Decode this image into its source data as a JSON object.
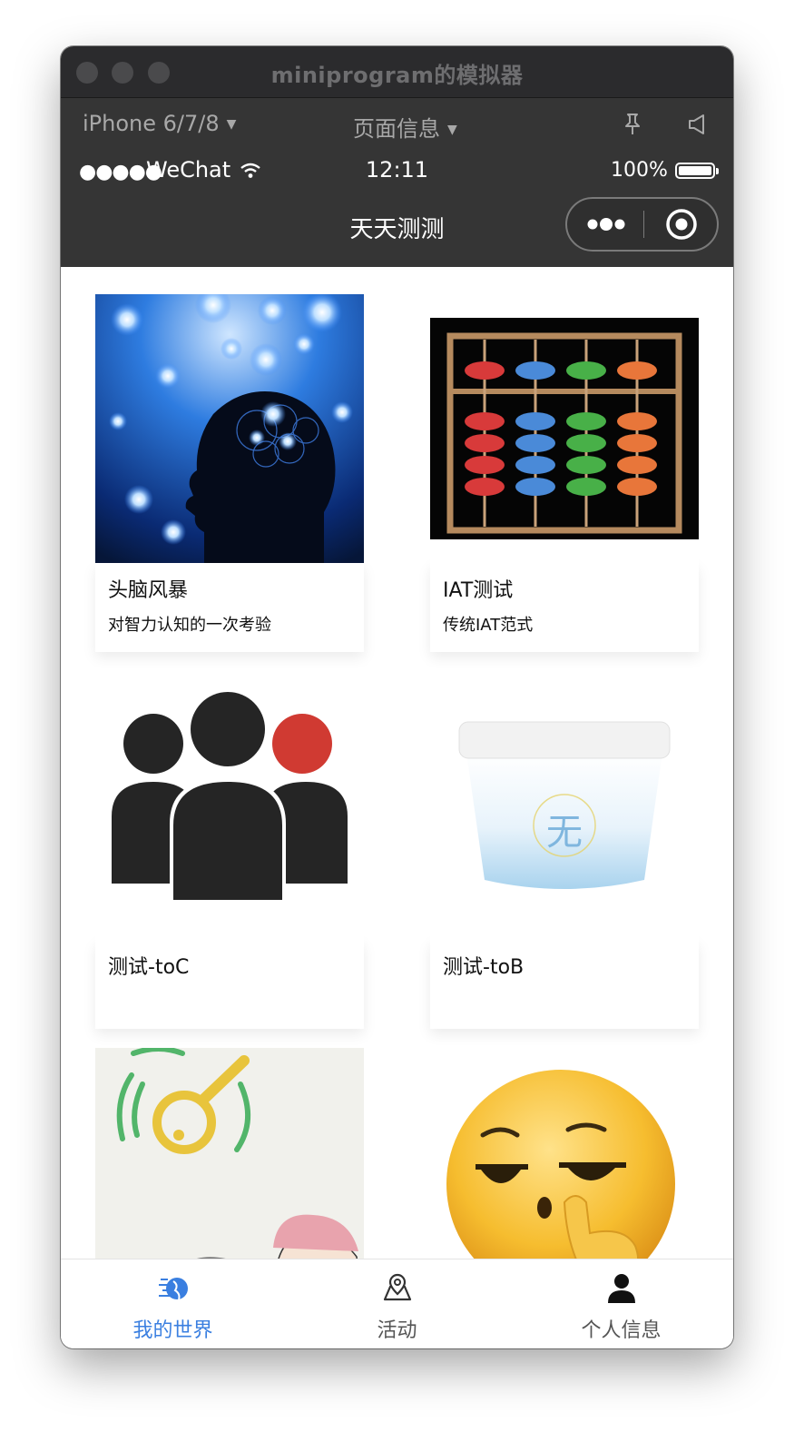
{
  "window": {
    "title": "miniprogram的模拟器"
  },
  "devbar": {
    "device": "iPhone 6/7/8",
    "page_info": "页面信息",
    "pin_icon": "pin-icon",
    "sound_icon": "speaker-icon"
  },
  "statusbar": {
    "signal": "●●●●●",
    "carrier": "WeChat",
    "time": "12:11",
    "battery": "100%",
    "battery_level": 1.0
  },
  "navbar": {
    "title": "天天测测"
  },
  "cards": [
    {
      "title": "头脑风暴",
      "desc": "对智力认知的一次考验",
      "image": "brain-illustration"
    },
    {
      "title": "IAT测试",
      "desc": "传统IAT范式",
      "image": "abacus-image"
    },
    {
      "title": "测试-toC",
      "desc": "",
      "image": "people-group-icon"
    },
    {
      "title": "测试-toB",
      "desc": "",
      "image": "yogurt-cup-image"
    },
    {
      "title": "",
      "desc": "",
      "image": "sketch-illustration"
    },
    {
      "title": "",
      "desc": "",
      "image": "emoji-face-image"
    }
  ],
  "tabbar": {
    "items": [
      {
        "label": "我的世界",
        "icon": "world-icon",
        "active": true
      },
      {
        "label": "活动",
        "icon": "map-pin-icon",
        "active": false
      },
      {
        "label": "个人信息",
        "icon": "person-icon",
        "active": false
      }
    ],
    "active_color": "#3a7fe0"
  }
}
